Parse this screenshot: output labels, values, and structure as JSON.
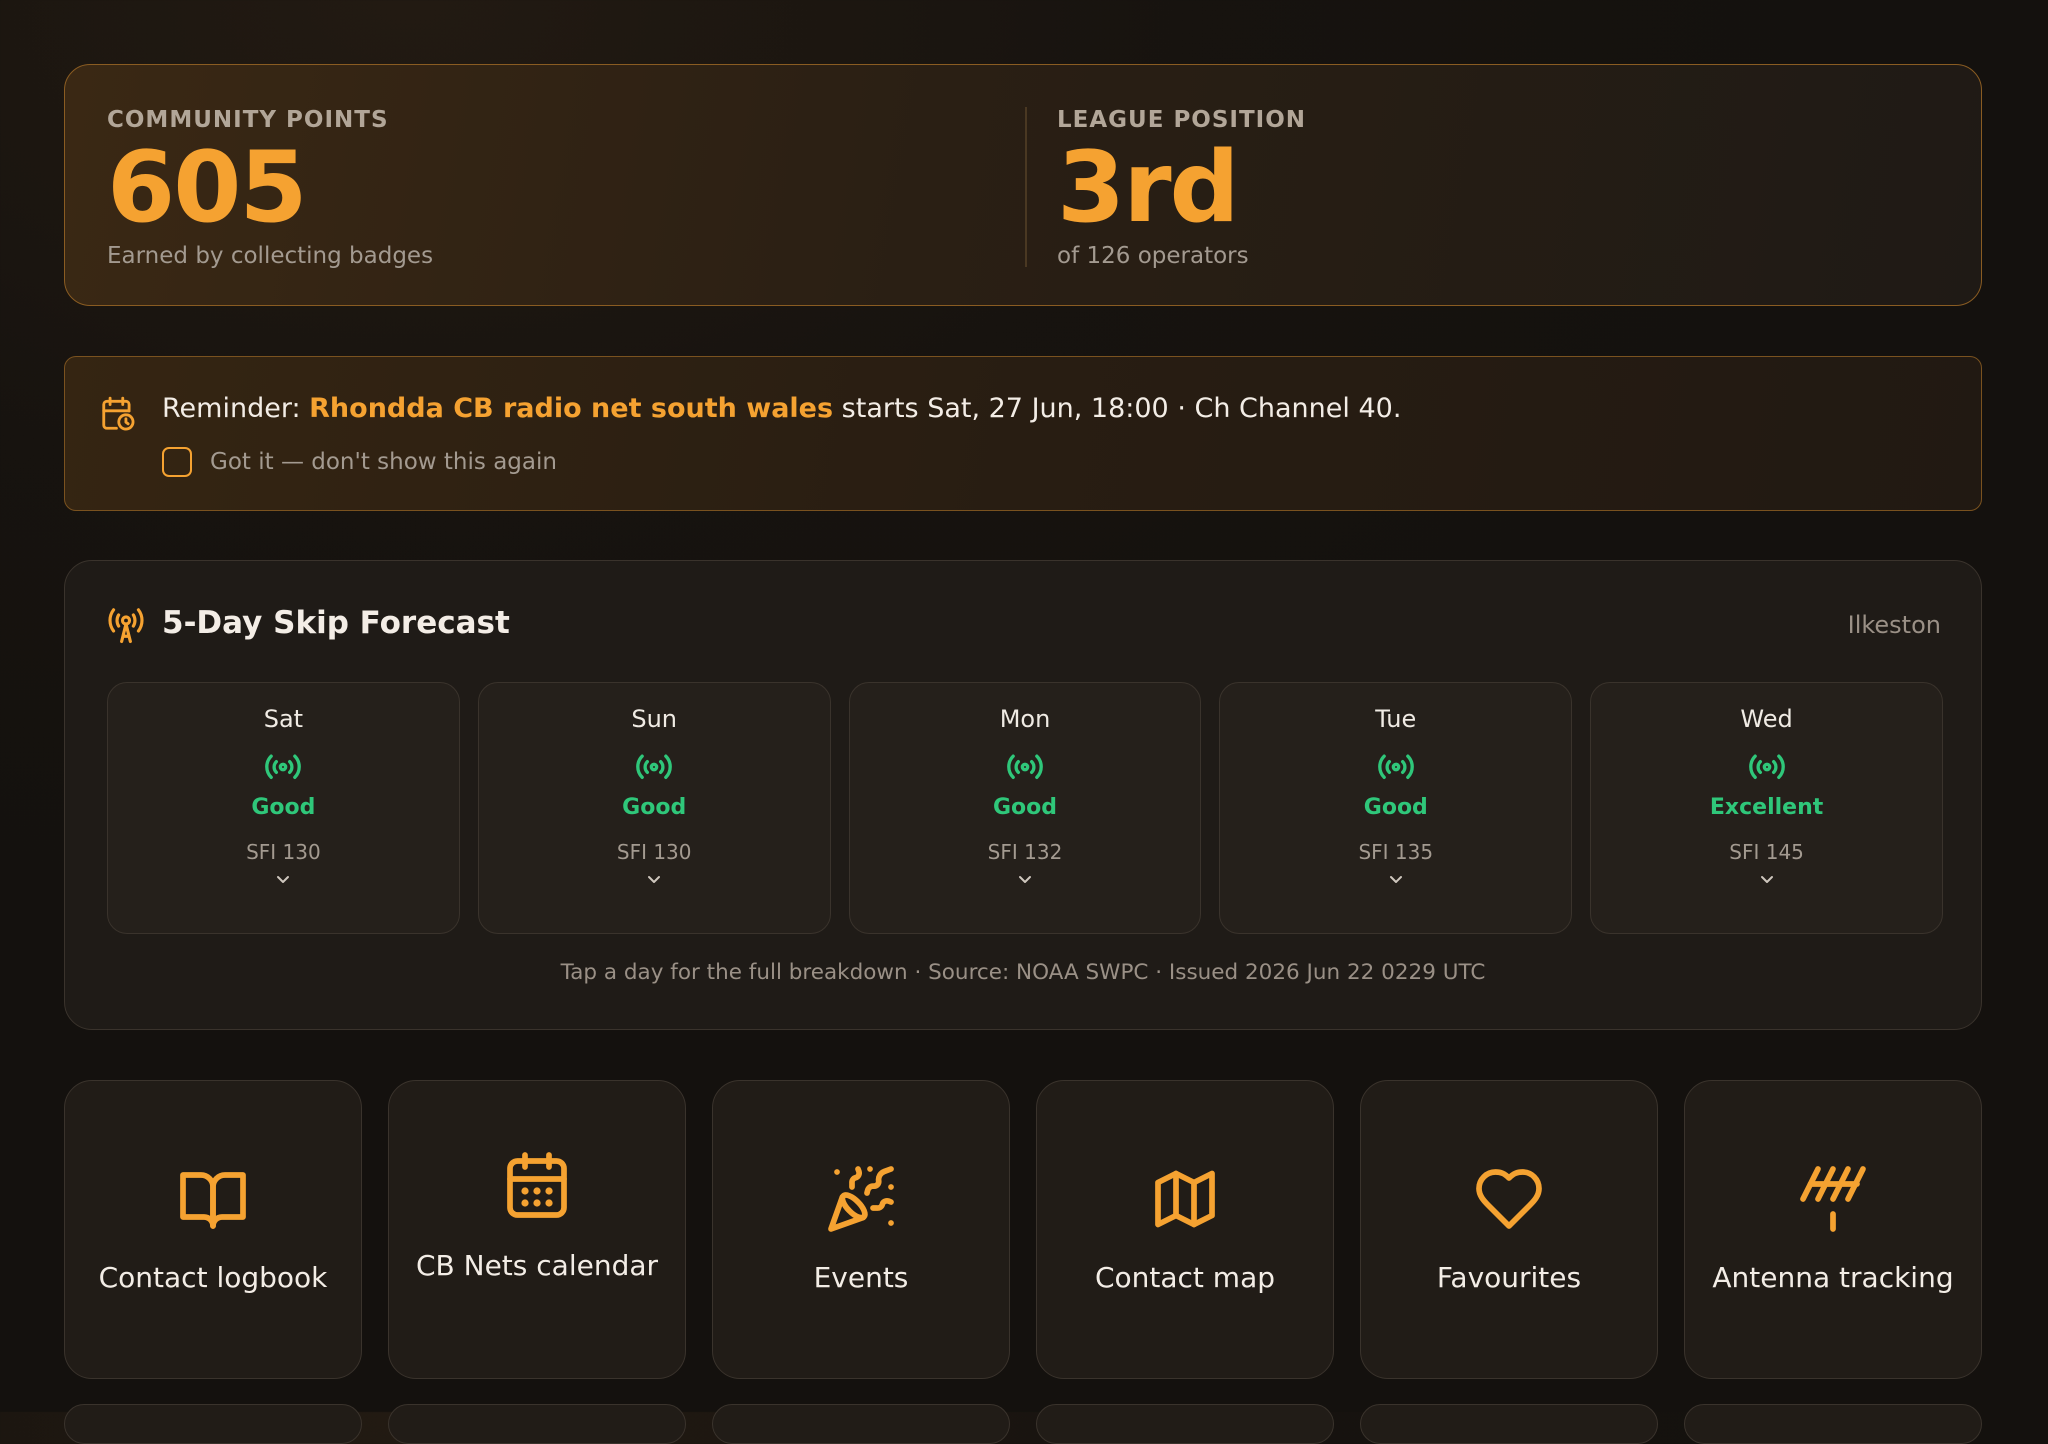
{
  "stats": {
    "points": {
      "label": "COMMUNITY POINTS",
      "value": "605",
      "sub": "Earned by collecting badges"
    },
    "league": {
      "label": "LEAGUE POSITION",
      "value": "3rd",
      "sub": "of 126 operators"
    }
  },
  "reminder": {
    "prefix": "Reminder: ",
    "event": "Rhondda CB radio net south wales",
    "suffix": " starts Sat, 27 Jun, 18:00 · Ch Channel 40.",
    "dismiss_label": "Got it — don't show this again"
  },
  "forecast": {
    "title": "5-Day Skip Forecast",
    "location": "Ilkeston",
    "days": [
      {
        "day": "Sat",
        "condition": "Good",
        "sfi": "SFI 130"
      },
      {
        "day": "Sun",
        "condition": "Good",
        "sfi": "SFI 130"
      },
      {
        "day": "Mon",
        "condition": "Good",
        "sfi": "SFI 132"
      },
      {
        "day": "Tue",
        "condition": "Good",
        "sfi": "SFI 135"
      },
      {
        "day": "Wed",
        "condition": "Excellent",
        "sfi": "SFI 145"
      }
    ],
    "footer": "Tap a day for the full breakdown · Source: NOAA SWPC · Issued 2026 Jun 22 0229 UTC"
  },
  "tiles": [
    {
      "label": "Contact logbook",
      "icon": "book-open-icon"
    },
    {
      "label": "CB Nets calendar",
      "icon": "calendar-icon"
    },
    {
      "label": "Events",
      "icon": "party-popper-icon"
    },
    {
      "label": "Contact map",
      "icon": "map-icon"
    },
    {
      "label": "Favourites",
      "icon": "heart-icon"
    },
    {
      "label": "Antenna tracking",
      "icon": "antenna-icon"
    }
  ],
  "colors": {
    "accent": "#f5a231",
    "good": "#2fc77a",
    "background": "#17130f",
    "card": "#211c17"
  }
}
